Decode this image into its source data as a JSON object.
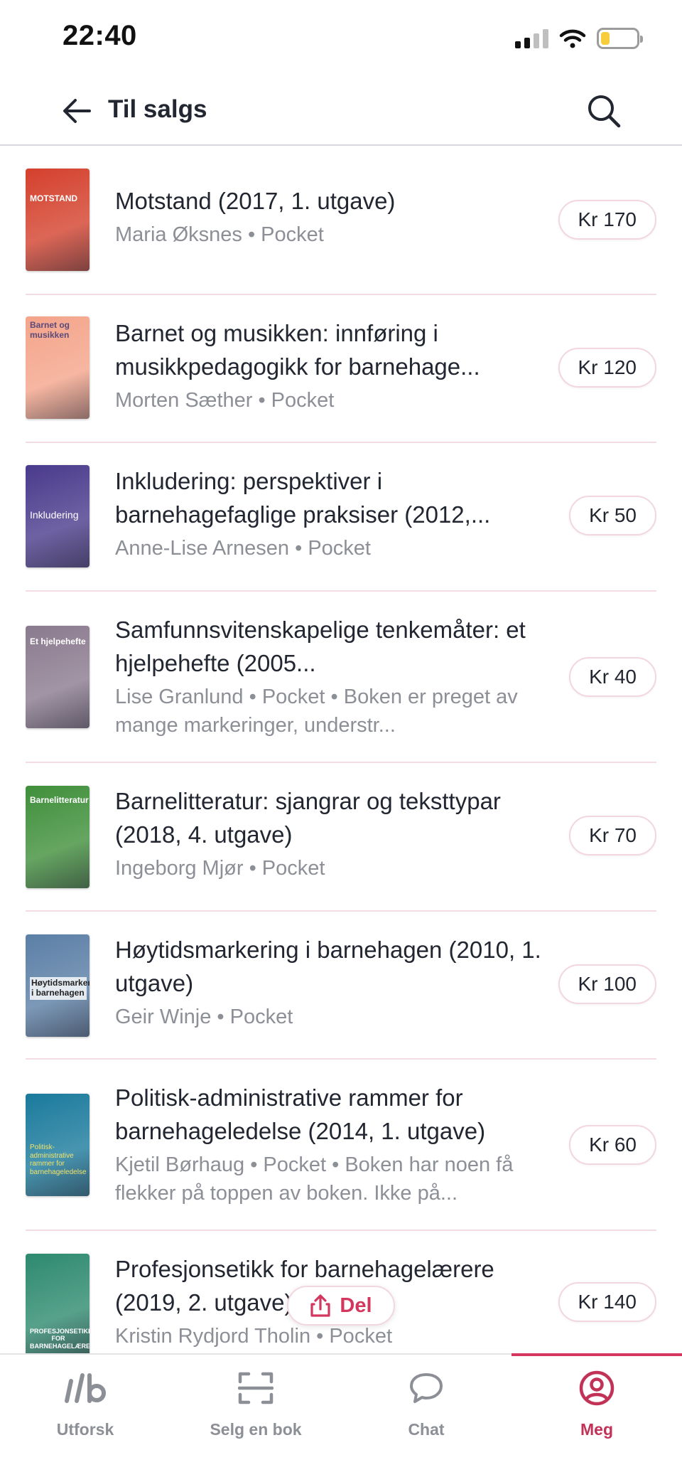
{
  "status_bar": {
    "time": "22:40",
    "icons": [
      "cellular-signal-icon",
      "wifi-icon",
      "battery-icon"
    ],
    "battery_level": 0.24
  },
  "header": {
    "title": "Til salgs",
    "back_icon": "arrow-left-icon",
    "search_icon": "search-icon"
  },
  "listings": [
    {
      "title": "Motstand (2017, 1. utgave)",
      "meta": "Maria Øksnes • Pocket",
      "price": "Kr 170",
      "cover_text": "MOTSTAND",
      "cover_color": "#d4402c"
    },
    {
      "title": "Barnet og musikken: innføring i musikkpedagogikk for barnehage...",
      "meta": "Morten Sæther • Pocket",
      "price": "Kr 120",
      "cover_text": "Barnet og musikken",
      "cover_color": "#f4a48a"
    },
    {
      "title": "Inkludering: perspektiver i barnehagefaglige praksiser (2012,...",
      "meta": "Anne-Lise Arnesen • Pocket",
      "price": "Kr 50",
      "cover_text": "Inkludering",
      "cover_color": "#4a3a8c"
    },
    {
      "title": "Samfunnsvitenskapelige tenkemåter: et hjelpehefte (2005...",
      "meta": "Lise Granlund • Pocket • Boken er preget av mange markeringer, understr...",
      "price": "Kr 40",
      "cover_text": "Et hjelpehefte",
      "cover_color": "#8a7a8e"
    },
    {
      "title": "Barnelitteratur: sjangrar og teksttypar (2018, 4. utgave)",
      "meta": "Ingeborg Mjør • Pocket",
      "price": "Kr 70",
      "cover_text": "Barnelitteratur",
      "cover_color": "#3f8f3a"
    },
    {
      "title": "Høytidsmarkering i barnehagen (2010, 1. utgave)",
      "meta": "Geir Winje • Pocket",
      "price": "Kr 100",
      "cover_text": "Høytidsmarkering i barnehagen",
      "cover_color": "#5b7fa6"
    },
    {
      "title": "Politisk-administrative rammer for barnehageledelse (2014, 1. utgave)",
      "meta": "Kjetil Børhaug • Pocket • Boken har noen få flekker på toppen av boken. Ikke på...",
      "price": "Kr 60",
      "cover_text": "Politisk-administrative rammer for barnehageledelse",
      "cover_color": "#1a7a9c"
    },
    {
      "title": "Profesjonsetikk for barnehagelærere (2019, 2. utgave)",
      "meta": "Kristin Rydjord Tholin • Pocket",
      "price": "Kr 140",
      "cover_text": "PROFESJONSETIKK FOR BARNEHAGELÆRERE",
      "cover_color": "#2d8a6e"
    }
  ],
  "share": {
    "label": "Del",
    "icon": "share-icon"
  },
  "tab_bar": {
    "tabs": [
      {
        "label": "Utforsk",
        "icon": "logo-ib-icon",
        "active": false
      },
      {
        "label": "Selg en bok",
        "icon": "scan-icon",
        "active": false
      },
      {
        "label": "Chat",
        "icon": "chat-bubble-icon",
        "active": false
      },
      {
        "label": "Meg",
        "icon": "profile-icon",
        "active": true
      }
    ]
  },
  "colors": {
    "accent": "#d4375d",
    "text": "#222631",
    "muted": "#8c8f96",
    "divider": "#f4dde2"
  }
}
